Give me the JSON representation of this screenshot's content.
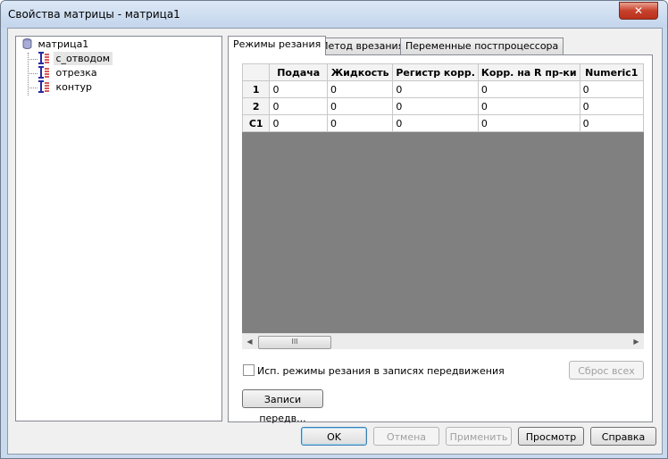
{
  "window": {
    "title": "Свойства матрицы - матрица1",
    "close_glyph": "✕"
  },
  "tree": {
    "root": {
      "label": "матрица1",
      "icon": "database-icon"
    },
    "items": [
      {
        "label": "с_отводом",
        "icon": "operation-icon",
        "color": "#d02020",
        "selected": true
      },
      {
        "label": "отрезка",
        "icon": "operation-icon",
        "color": "#d02020"
      },
      {
        "label": "контур",
        "icon": "operation-icon",
        "color": "#d02020"
      }
    ]
  },
  "tabs": [
    {
      "label": "Режимы резания",
      "active": true
    },
    {
      "label": "Метод врезания"
    },
    {
      "label": "Переменные постпроцессора"
    }
  ],
  "grid": {
    "columns": [
      "Подача",
      "Жидкость",
      "Регистр корр.",
      "Корр. на R пр-ки",
      "Numeric1"
    ],
    "rows": [
      {
        "header": "1",
        "cells": [
          "0",
          "0",
          "0",
          "0",
          "0"
        ]
      },
      {
        "header": "2",
        "cells": [
          "0",
          "0",
          "0",
          "0",
          "0"
        ]
      },
      {
        "header": "C1",
        "cells": [
          "0",
          "0",
          "0",
          "0",
          "0"
        ]
      }
    ]
  },
  "scrollbar": {
    "left": "◀",
    "right": "▶",
    "grip": "III"
  },
  "checkbox_label": "Исп. режимы резания в записях передвижения",
  "reset_all": "Сброс всех",
  "records_button": "Записи передв...",
  "footer": {
    "ok": "OK",
    "cancel": "Отмена",
    "apply": "Применить",
    "preview": "Просмотр",
    "help": "Справка"
  }
}
